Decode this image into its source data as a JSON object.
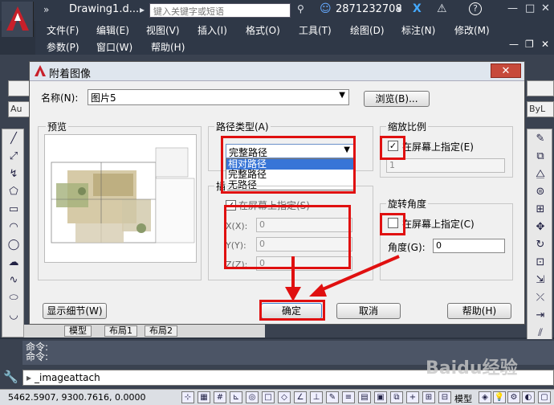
{
  "app": {
    "doc_title": "Drawing1.d...",
    "search_placeholder": "键入关键字或短语",
    "user_id": "2871232708",
    "help_label": "?"
  },
  "menu": {
    "row1": [
      "文件(F)",
      "编辑(E)",
      "视图(V)",
      "插入(I)",
      "格式(O)",
      "工具(T)",
      "绘图(D)",
      "标注(N)",
      "修改(M)"
    ],
    "row2": [
      "参数(P)",
      "窗口(W)",
      "帮助(H)"
    ]
  },
  "side": {
    "au_tab": "Au",
    "bylayer": "ByL"
  },
  "layout_tabs": [
    "模型",
    "布局1",
    "布局2"
  ],
  "dialog": {
    "title": "附着图像",
    "close_label": "✕",
    "name_label": "名称(N):",
    "name_value": "图片5",
    "browse_label": "浏览(B)...",
    "preview_label": "预览",
    "path_type_label": "路径类型(A)",
    "path_type_value": "完整路径",
    "path_options": [
      "相对路径",
      "完整路径",
      "无路径"
    ],
    "insert_point_label": "插",
    "insert_onscreen_label": "在屏幕上指定(S)",
    "insert_onscreen_checked": true,
    "x_label": "X(X):",
    "y_label": "Y(Y):",
    "z_label": "Z(Z):",
    "x_value": "0",
    "y_value": "0",
    "z_value": "0",
    "scale_label": "缩放比例",
    "scale_onscreen_label": "在屏幕上指定(E)",
    "scale_onscreen_checked": true,
    "scale_value": "1",
    "rotation_label": "旋转角度",
    "rotation_onscreen_label": "在屏幕上指定(C)",
    "rotation_onscreen_checked": false,
    "angle_label": "角度(G):",
    "angle_value": "0",
    "show_details_label": "显示细节(W)",
    "ok_label": "确定",
    "cancel_label": "取消",
    "help_label": "帮助(H)"
  },
  "command": {
    "line1": "命令:",
    "line2": "命令:",
    "input": "_imageattach"
  },
  "status": {
    "coords": "5462.5907,  9300.7616, 0.0000",
    "model_label": "模型"
  },
  "watermark": "Baidu经验",
  "colors": {
    "title_bar": "#2f3847",
    "highlight_red": "#e01010",
    "selection_blue": "#3875d7"
  }
}
